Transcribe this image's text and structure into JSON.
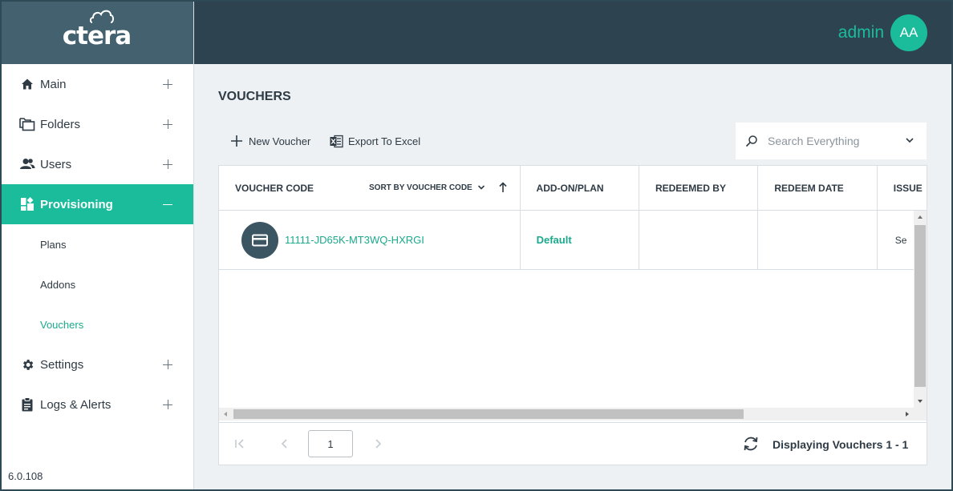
{
  "brand": {
    "logo_text": "ctera",
    "version": "6.0.108"
  },
  "header": {
    "user_name": "admin",
    "avatar_initials": "AA"
  },
  "sidebar": {
    "items": [
      {
        "label": "Main",
        "icon": "home-icon",
        "expanded": false
      },
      {
        "label": "Folders",
        "icon": "folders-icon",
        "expanded": false
      },
      {
        "label": "Users",
        "icon": "users-icon",
        "expanded": false
      },
      {
        "label": "Provisioning",
        "icon": "provisioning-icon",
        "expanded": true,
        "active": true,
        "children": [
          {
            "label": "Plans"
          },
          {
            "label": "Addons"
          },
          {
            "label": "Vouchers",
            "current": true
          }
        ]
      },
      {
        "label": "Settings",
        "icon": "gear-icon",
        "expanded": false
      },
      {
        "label": "Logs & Alerts",
        "icon": "clipboard-icon",
        "expanded": false
      }
    ]
  },
  "main": {
    "title": "VOUCHERS",
    "toolbar": {
      "new_label": "New Voucher",
      "export_label": "Export To Excel"
    },
    "search": {
      "placeholder": "Search Everything"
    },
    "table": {
      "columns": [
        "VOUCHER CODE",
        "ADD-ON/PLAN",
        "REDEEMED BY",
        "REDEEM DATE",
        "ISSUE"
      ],
      "sort_label": "SORT BY VOUCHER CODE",
      "rows": [
        {
          "code": "11111-JD65K-MT3WQ-HXRGI",
          "plan": "Default",
          "redeemed_by": "",
          "redeem_date": "",
          "issue": "Se"
        }
      ]
    },
    "pager": {
      "page": "1",
      "display_text": "Displaying Vouchers 1 - 1"
    }
  },
  "colors": {
    "accent": "#1abc9c",
    "header_bg": "#2d4450",
    "logo_bg": "#43616f"
  }
}
